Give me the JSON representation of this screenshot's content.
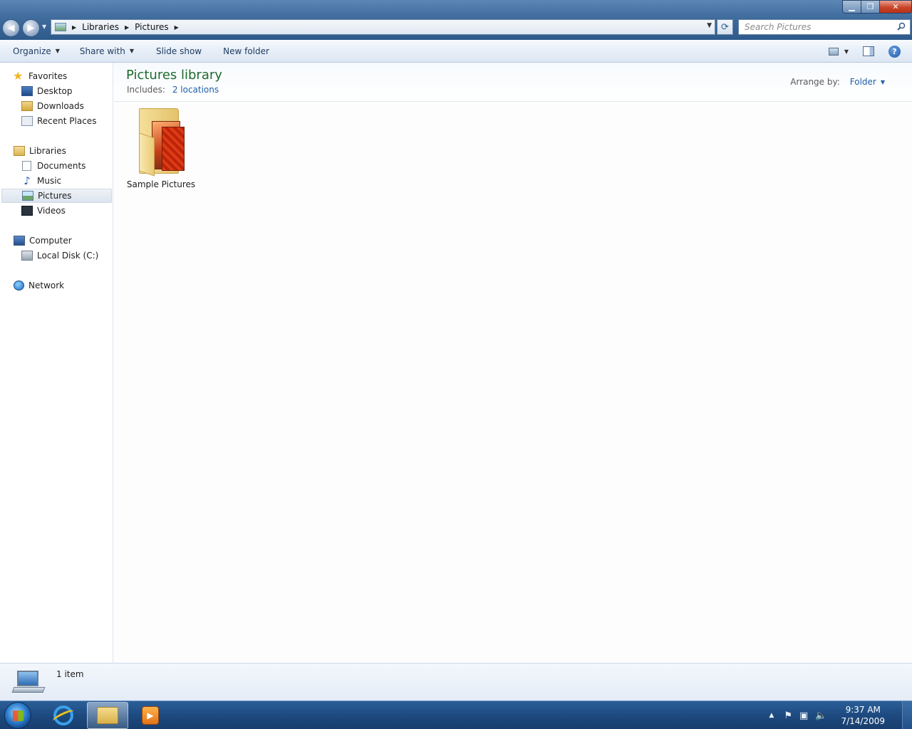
{
  "window": {
    "controls": {
      "minimize": "▁",
      "maximize": "❐",
      "close": "✕"
    }
  },
  "nav": {
    "back": "◀",
    "forward": "▶"
  },
  "address": {
    "crumbs": [
      "Libraries",
      "Pictures"
    ],
    "separator": "▶"
  },
  "search": {
    "placeholder": "Search Pictures"
  },
  "toolbar": {
    "organize": "Organize",
    "share_with": "Share with",
    "slide_show": "Slide show",
    "new_folder": "New folder",
    "help": "?"
  },
  "sidebar": {
    "favorites": {
      "label": "Favorites",
      "items": [
        "Desktop",
        "Downloads",
        "Recent Places"
      ]
    },
    "libraries": {
      "label": "Libraries",
      "items": [
        "Documents",
        "Music",
        "Pictures",
        "Videos"
      ],
      "selected": "Pictures"
    },
    "computer": {
      "label": "Computer",
      "items": [
        "Local Disk (C:)"
      ]
    },
    "network": {
      "label": "Network"
    }
  },
  "library": {
    "title": "Pictures library",
    "includes_label": "Includes:",
    "includes_link": "2 locations",
    "arrange_label": "Arrange by:",
    "arrange_value": "Folder"
  },
  "items": [
    {
      "name": "Sample Pictures",
      "type": "folder"
    }
  ],
  "details": {
    "count": "1 item"
  },
  "taskbar": {
    "apps": [
      "internet-explorer",
      "windows-explorer",
      "windows-media-player"
    ],
    "active_app": "windows-explorer"
  },
  "clock": {
    "time": "9:37 AM",
    "date": "7/14/2009"
  },
  "colors": {
    "title_bar": "#3f6b9d",
    "library_title": "#1e6b2f",
    "link": "#1f5ea8",
    "taskbar": "#1d4a80"
  }
}
